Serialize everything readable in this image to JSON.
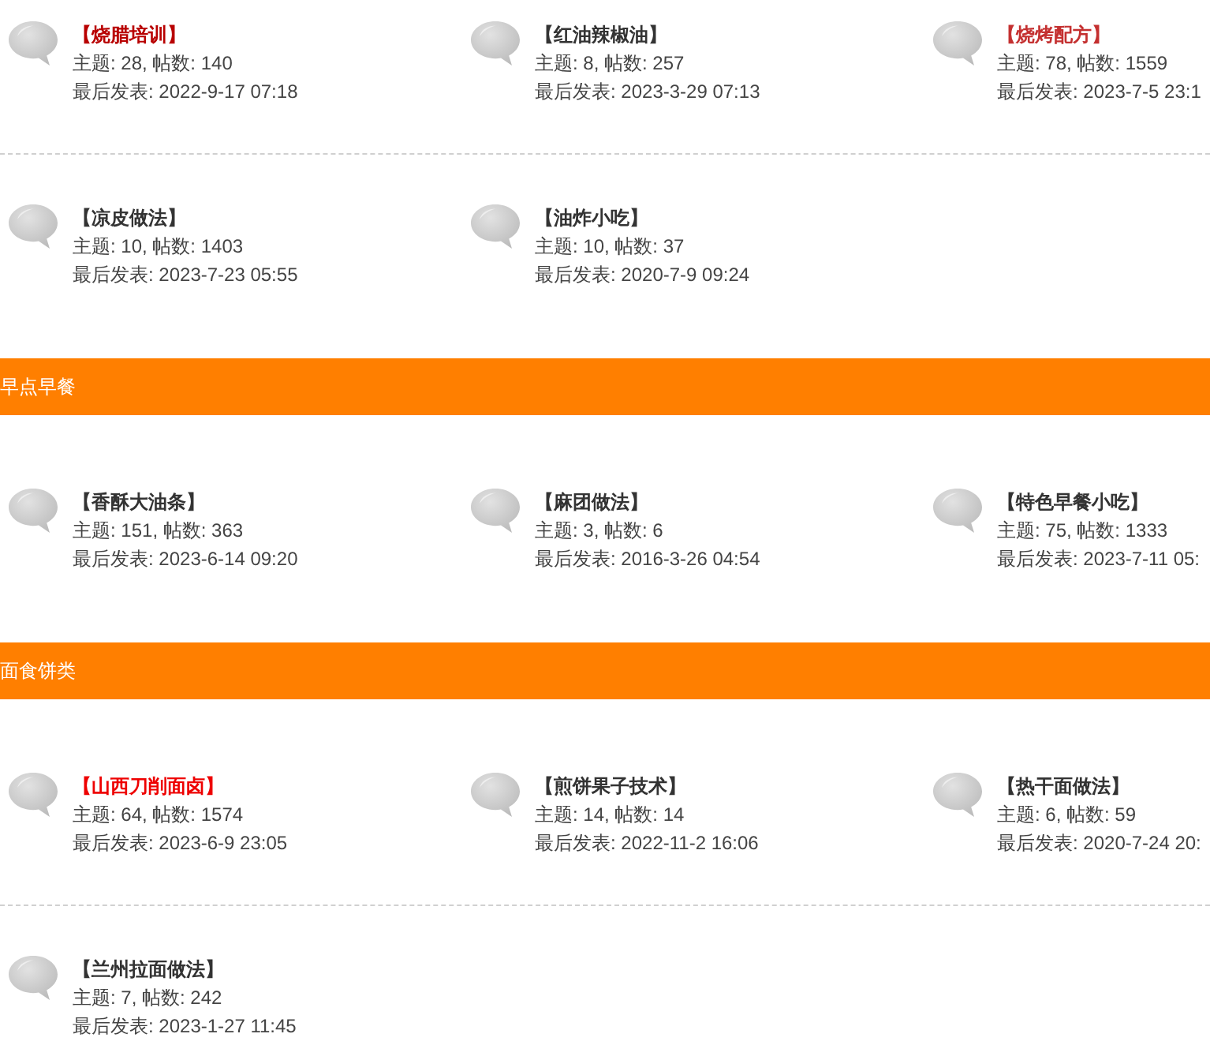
{
  "groups": [
    {
      "rows": [
        {
          "forums": [
            {
              "name": "【烧腊培训】",
              "color": "#b80000",
              "stats": "主题: 28, 帖数: 140",
              "last_post": "最后发表: 2022-9-17 07:18"
            },
            {
              "name": "【红油辣椒油】",
              "color": "#333333",
              "stats": "主题: 8, 帖数: 257",
              "last_post": "最后发表: 2023-3-29 07:13"
            },
            {
              "name": "【烧烤配方】",
              "color": "#c43030",
              "stats": "主题: 78, 帖数: 1559",
              "last_post": "最后发表: 2023-7-5 23:1"
            }
          ]
        },
        {
          "forums": [
            {
              "name": "【凉皮做法】",
              "color": "#333333",
              "stats": "主题: 10, 帖数: 1403",
              "last_post": "最后发表: 2023-7-23 05:55"
            },
            {
              "name": "【油炸小吃】",
              "color": "#333333",
              "stats": "主题: 10, 帖数: 37",
              "last_post": "最后发表: 2020-7-9 09:24"
            }
          ]
        }
      ]
    },
    {
      "header": "早点早餐",
      "rows": [
        {
          "forums": [
            {
              "name": "【香酥大油条】",
              "color": "#333333",
              "stats": "主题: 151, 帖数: 363",
              "last_post": "最后发表: 2023-6-14 09:20"
            },
            {
              "name": "【麻团做法】",
              "color": "#333333",
              "stats": "主题: 3, 帖数: 6",
              "last_post": "最后发表: 2016-3-26 04:54"
            },
            {
              "name": "【特色早餐小吃】",
              "color": "#333333",
              "stats": "主题: 75, 帖数: 1333",
              "last_post": "最后发表: 2023-7-11 05:"
            }
          ]
        }
      ]
    },
    {
      "header": "面食饼类",
      "rows": [
        {
          "forums": [
            {
              "name": "【山西刀削面卤】",
              "color": "#ee0000",
              "stats": "主题: 64, 帖数: 1574",
              "last_post": "最后发表: 2023-6-9 23:05"
            },
            {
              "name": "【煎饼果子技术】",
              "color": "#333333",
              "stats": "主题: 14, 帖数: 14",
              "last_post": "最后发表: 2022-11-2 16:06"
            },
            {
              "name": "【热干面做法】",
              "color": "#333333",
              "stats": "主题: 6, 帖数: 59",
              "last_post": "最后发表: 2020-7-24 20:"
            }
          ]
        },
        {
          "forums": [
            {
              "name": "【兰州拉面做法】",
              "color": "#333333",
              "stats": "主题: 7, 帖数: 242",
              "last_post": "最后发表: 2023-1-27 11:45"
            }
          ]
        }
      ]
    }
  ]
}
